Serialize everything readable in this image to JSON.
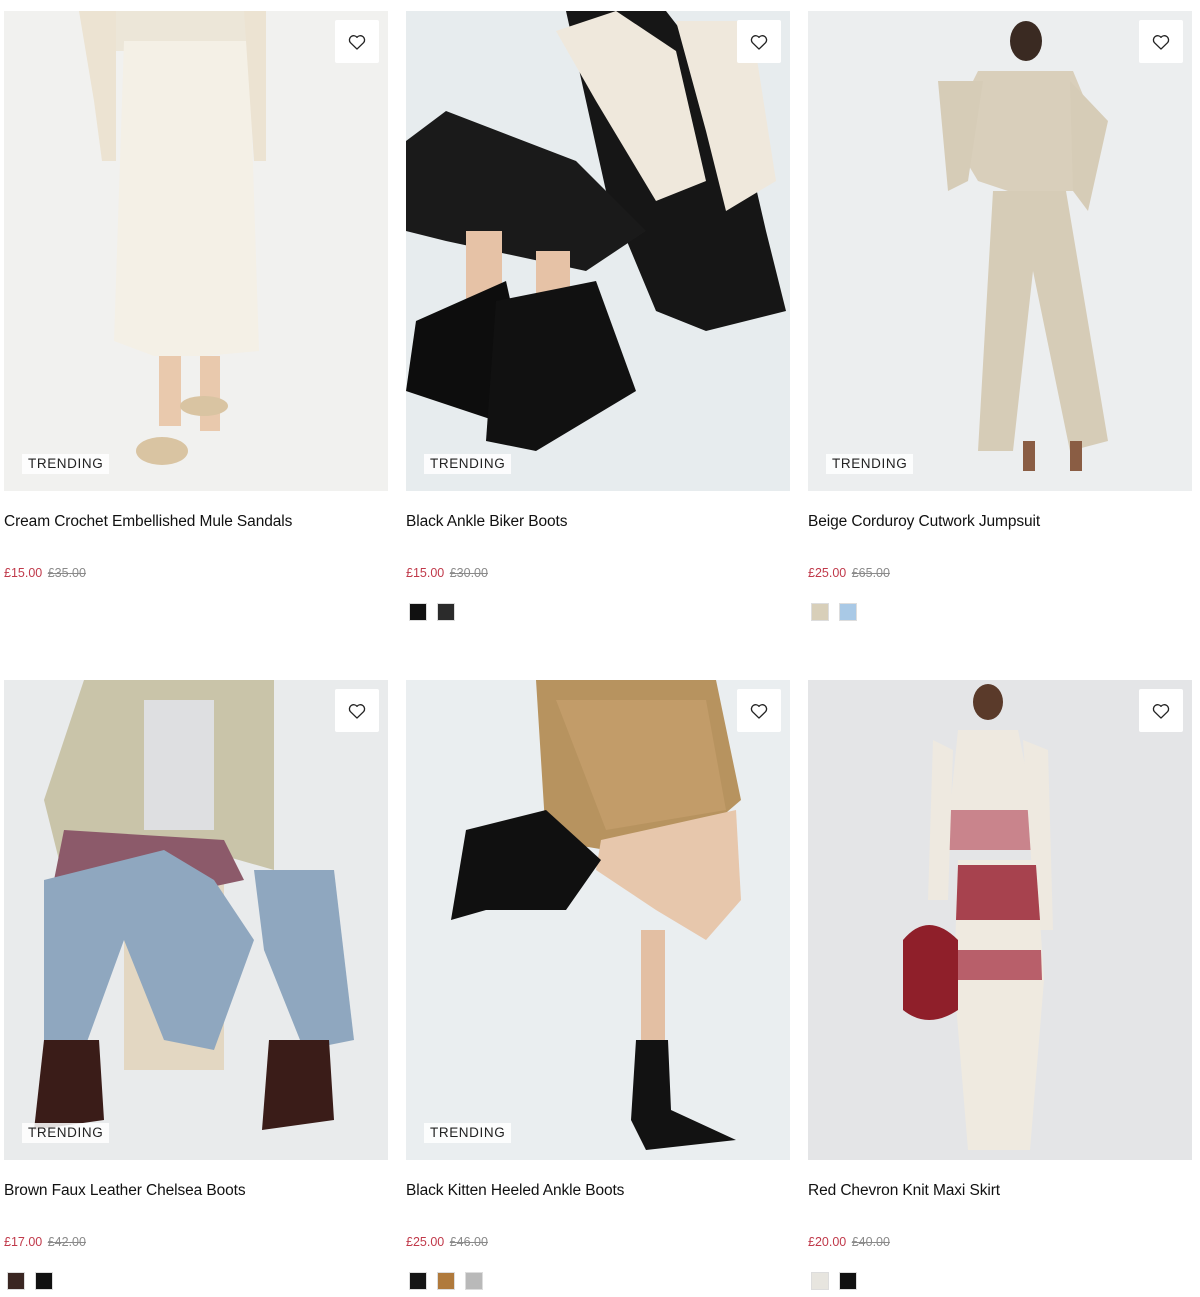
{
  "products": [
    {
      "name": "Cream Crochet Embellished Mule Sandals",
      "price_sale": "£15.00",
      "price_was": "£35.00",
      "badge": "TRENDING",
      "bg": "#f1f1ef",
      "swatches": []
    },
    {
      "name": "Black Ankle Biker Boots",
      "price_sale": "£15.00",
      "price_was": "£30.00",
      "badge": "TRENDING",
      "bg": "#e7ecee",
      "swatches": [
        "#111111",
        "#2b2b2b"
      ]
    },
    {
      "name": "Beige Corduroy Cutwork Jumpsuit",
      "price_sale": "£25.00",
      "price_was": "£65.00",
      "badge": "TRENDING",
      "bg": "#eceeef",
      "swatches": [
        "#d8cfb9",
        "#a9c9e6"
      ]
    },
    {
      "name": "Brown Faux Leather Chelsea Boots",
      "price_sale": "£17.00",
      "price_was": "£42.00",
      "badge": "TRENDING",
      "bg": "#e9ebec",
      "swatches": [
        "#3a2622",
        "#111111"
      ]
    },
    {
      "name": "Black Kitten Heeled Ankle Boots",
      "price_sale": "£25.00",
      "price_was": "£46.00",
      "badge": "TRENDING",
      "bg": "#eaeef0",
      "swatches": [
        "#151515",
        "#b07a3c",
        "#b9b9b9"
      ]
    },
    {
      "name": "Red Chevron Knit Maxi Skirt",
      "price_sale": "£20.00",
      "price_was": "£40.00",
      "badge": "",
      "bg": "#e4e5e7",
      "swatches": [
        "#e7e5df",
        "#111111"
      ]
    }
  ],
  "icons": {
    "wishlist": "heart-icon"
  },
  "colors": {
    "sale": "#c0394a",
    "was": "#8a8a8a"
  }
}
